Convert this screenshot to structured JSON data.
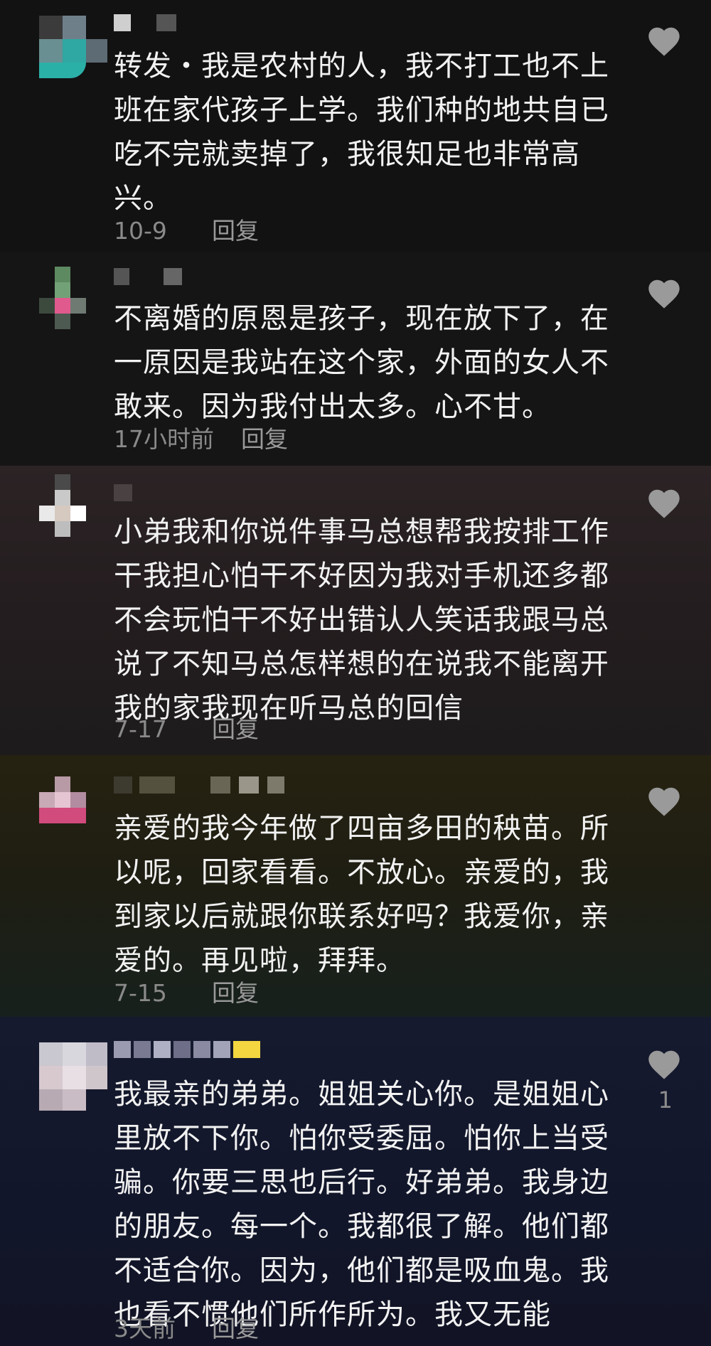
{
  "comments": [
    {
      "text": "转发・我是农村的人，我不打工也不上\n班在家代孩子上学。我们种的地共自已\n吃不完就卖掉了，我很知足也非常高\n兴。",
      "date": "10-9",
      "reply_label": "回复",
      "likes": ""
    },
    {
      "text": "不离婚的原恩是孩子，现在放下了，在\n一原因是我站在这个家，外面的女人不\n敢来。因为我付出太多。心不甘。",
      "date": "17小时前",
      "reply_label": "回复",
      "likes": ""
    },
    {
      "text": "小弟我和你说件事马总想帮我按排工作\n干我担心怕干不好因为我对手机还多都\n不会玩怕干不好出错认人笑话我跟马总\n说了不知马总怎样想的在说我不能离开\n我的家我现在听马总的回信",
      "date": "7-17",
      "reply_label": "回复",
      "likes": ""
    },
    {
      "text": "亲爱的我今年做了四亩多田的秧苗。所\n以呢，回家看看。不放心。亲爱的，我\n到家以后就跟你联系好吗？我爱你，亲\n爱的。再见啦，拜拜。",
      "date": "7-15",
      "reply_label": "回复",
      "likes": ""
    },
    {
      "text": "我最亲的弟弟。姐姐关心你。是姐姐心\n里放不下你。怕你受委屈。怕你上当受\n骗。你要三思也后行。好弟弟。我身边\n的朋友。每一个。我都很了解。他们都\n不适合你。因为，他们都是吸血鬼。我\n也看不惯他们所作所为。我又无能",
      "date": "3天前",
      "reply_label": "回复",
      "likes": "1"
    }
  ],
  "colors": {
    "text": "#f2f2f2",
    "meta": "#8a8a8a",
    "heart": "#9a9a9a"
  },
  "icons": [
    "heart-icon"
  ]
}
